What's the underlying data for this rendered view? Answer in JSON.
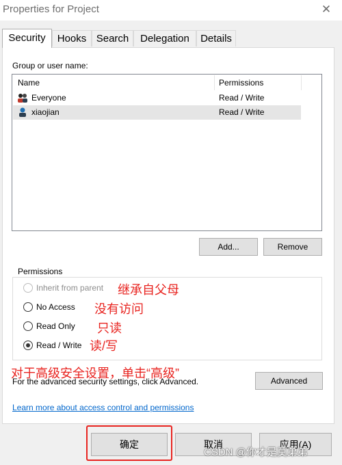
{
  "window": {
    "title": "Properties for Project",
    "close_glyph": "✕"
  },
  "tabs": [
    {
      "label": "Security",
      "active": true
    },
    {
      "label": "Hooks"
    },
    {
      "label": "Search"
    },
    {
      "label": "Delegation"
    },
    {
      "label": "Details"
    }
  ],
  "security": {
    "group_label": "Group or user name:",
    "columns": [
      "Name",
      "Permissions"
    ],
    "rows": [
      {
        "name": "Everyone",
        "permissions": "Read / Write",
        "icon": "user-group-icon"
      },
      {
        "name": "xiaojian",
        "permissions": "Read / Write",
        "icon": "user-icon",
        "selected": true
      }
    ],
    "add_label": "Add...",
    "remove_label": "Remove"
  },
  "permissions": {
    "title": "Permissions",
    "options": [
      {
        "label": "Inherit from parent",
        "annotation": "继承自父母",
        "disabled": true
      },
      {
        "label": "No Access",
        "annotation": "没有访问"
      },
      {
        "label": "Read Only",
        "annotation": "只读"
      },
      {
        "label": "Read / Write",
        "annotation": "读/写",
        "checked": true
      }
    ]
  },
  "advanced": {
    "annotation": "对于高级安全设置，单击“高级”",
    "text": "For the advanced security settings, click Advanced.",
    "button_label": "Advanced"
  },
  "learn_more": "Learn more about access control and permissions",
  "footer": {
    "ok_label": "确定",
    "cancel_label": "取消",
    "apply_label": "应用(A)"
  },
  "watermark": "CSDN @你才是莫弟弟",
  "colors": {
    "annotation": "#e8231f",
    "link": "#0066cc"
  }
}
